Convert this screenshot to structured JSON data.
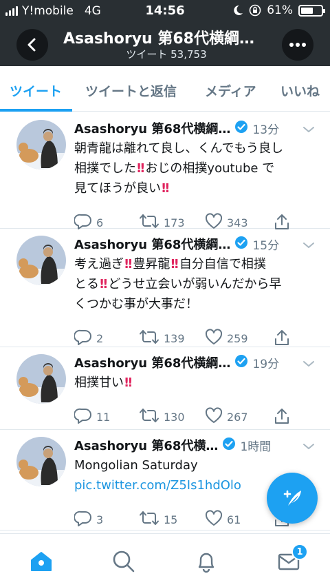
{
  "status_bar": {
    "carrier": "Y!mobile",
    "network": "4G",
    "time": "14:56",
    "battery": "61%",
    "battery_level": 0.61
  },
  "header": {
    "title": "Asashoryu 第68代横綱…",
    "subtitle": "ツイート 53,753"
  },
  "tabs": [
    {
      "label": "ツイート",
      "active": true
    },
    {
      "label": "ツイートと返信",
      "active": false
    },
    {
      "label": "メディア",
      "active": false
    },
    {
      "label": "いいね",
      "active": false
    }
  ],
  "tweets": [
    {
      "name": "Asashoryu 第68代横綱…",
      "time": "13分",
      "lines": [
        [
          "朝青龍は離れて良し、くんでもう良し"
        ],
        [
          "相撲でした",
          "!!",
          "おじの相撲youtube で"
        ],
        [
          "見てほうが良い",
          "!!"
        ]
      ],
      "replies": "6",
      "retweets": "173",
      "likes": "343"
    },
    {
      "name": "Asashoryu 第68代横綱…",
      "time": "15分",
      "lines": [
        [
          "考え過ぎ",
          "!!",
          "豊昇龍",
          "!!",
          "自分自信で相撲"
        ],
        [
          "とる",
          "!!",
          "どうせ立会いが弱いんだから早"
        ],
        [
          "くつかむ事が大事だ！"
        ]
      ],
      "replies": "2",
      "retweets": "139",
      "likes": "259"
    },
    {
      "name": "Asashoryu 第68代横綱…",
      "time": "19分",
      "lines": [
        [
          "相撲甘い",
          "!!"
        ]
      ],
      "replies": "11",
      "retweets": "130",
      "likes": "267"
    },
    {
      "name": "Asashoryu 第68代横…",
      "time": "1時間",
      "lines": [
        [
          "Mongolian Saturday"
        ]
      ],
      "link": "pic.twitter.com/Z5Is1hdOlo",
      "replies": "3",
      "retweets": "15",
      "likes": "61"
    }
  ],
  "tabbar": {
    "messages_badge": "1",
    "active": "home"
  },
  "colors": {
    "accent": "#1da1f2",
    "header_bg": "#292f33",
    "secondary_text": "#657786",
    "exclaim": "#e0245e"
  },
  "icons": {
    "back": "chevron-left-icon",
    "more": "more-dots-icon",
    "verified": "verified-badge-icon",
    "caret": "chevron-down-icon",
    "reply": "reply-icon",
    "retweet": "retweet-icon",
    "like": "heart-icon",
    "share": "share-icon",
    "compose": "compose-tweet-icon",
    "home": "home-icon",
    "search": "search-icon",
    "notifications": "bell-icon",
    "messages": "envelope-icon"
  }
}
